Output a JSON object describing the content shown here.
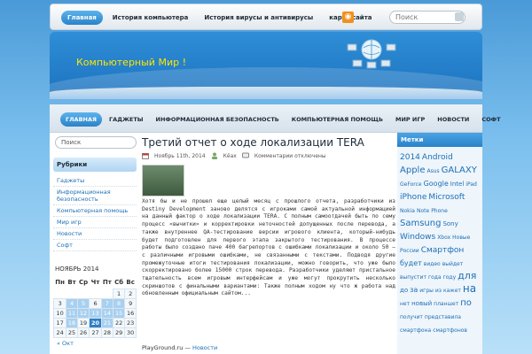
{
  "top_nav": [
    "Главная",
    "История компьютера",
    "История вирусы и антивирусы",
    "карта сайта"
  ],
  "top_search_placeholder": "Поиск",
  "site_title": "Компьютерный Мир !",
  "main_nav": [
    "ГЛАВНАЯ",
    "ГАДЖЕТЫ",
    "ИНФОРМАЦИОННАЯ БЕЗОПАСНОСТЬ",
    "КОМПЬЮТЕРНАЯ ПОМОЩЬ",
    "МИР ИГР",
    "НОВОСТИ",
    "СОФТ"
  ],
  "left": {
    "search_placeholder": "Поиск",
    "rubrics_title": "Рубрики",
    "rubrics": [
      "Гаджеты",
      "Информационная безопасность",
      "Компьютерная помощь",
      "Мир игр",
      "Новости",
      "Софт"
    ],
    "calendar_caption": "НОЯБРЬ 2014",
    "weekdays": [
      "Пн",
      "Вт",
      "Ср",
      "Чт",
      "Пт",
      "Сб",
      "Вс"
    ],
    "weeks": [
      [
        "",
        "",
        "",
        "",
        "",
        "1",
        "2"
      ],
      [
        "3",
        "4",
        "5",
        "6",
        "7",
        "8",
        "9"
      ],
      [
        "10",
        "11",
        "12",
        "13",
        "14",
        "15",
        "16"
      ],
      [
        "17",
        "18",
        "19",
        "20",
        "21",
        "22",
        "23"
      ],
      [
        "24",
        "25",
        "26",
        "27",
        "28",
        "29",
        "30"
      ]
    ],
    "linked_days": [
      "4",
      "5",
      "7",
      "8",
      "11",
      "12",
      "13",
      "14",
      "15",
      "18",
      "21"
    ],
    "today": "20",
    "prev_month": "« Окт"
  },
  "post": {
    "title": "Третий отчет о ходе локализации TERA",
    "date": "Ноябрь 11th, 2014",
    "author": "Кёах",
    "comments": "Комментарии отключены",
    "body": "Хотя бы и не прошел еще целый месяц с прошлого отчета, разработчики из Destiny Development заново делятся с игроками самой актуальной информацией на данный фактор о ходе локализации TERA. С полным самоотдачей быть по сему процесс «вычитки» и корректировки неточностей допущенных после перевода, а также внутреннее QA-тестирование версии игрового клиента, который-нибудь будет подготовлен для первого этапа закрытого тестирования. В процессе работы было создано паче 400 багрепортов с ошибками локализации и около 50 — с различными игровыми ошибками, не связанными с текстами. Подводя другие промежуточные итоги тестирования локализации, можно говорить, что уже было скорректировано более 15000 строк перевода. Разработчики уделяют пристальное тщательность всем игровым интерфейсам и уже могут прокрутить несколько скриншотов с финальными вариантами: Также полным ходом ну что ж работа над обновленным официальным сайтом...",
    "source": "PlayGround.ru",
    "source_sep": " — ",
    "category": "Новости"
  },
  "tags_title": "Метки",
  "tags": [
    {
      "t": "2014",
      "s": 9
    },
    {
      "t": "Android",
      "s": 9
    },
    {
      "t": "Apple",
      "s": 10
    },
    {
      "t": "Asus",
      "s": 6
    },
    {
      "t": "GALAXY",
      "s": 10
    },
    {
      "t": "GeForce",
      "s": 6
    },
    {
      "t": "Google",
      "s": 8
    },
    {
      "t": "Intel",
      "s": 7
    },
    {
      "t": "iPad",
      "s": 6
    },
    {
      "t": "iPhone",
      "s": 9
    },
    {
      "t": "Microsoft",
      "s": 9
    },
    {
      "t": "Nokia",
      "s": 6
    },
    {
      "t": "Note",
      "s": 6
    },
    {
      "t": "Phone",
      "s": 6
    },
    {
      "t": "Samsung",
      "s": 10
    },
    {
      "t": "Sony",
      "s": 7
    },
    {
      "t": "Windows",
      "s": 9
    },
    {
      "t": "Xbox",
      "s": 6
    },
    {
      "t": "Новые",
      "s": 6
    },
    {
      "t": "России",
      "s": 6
    },
    {
      "t": "Смартфон",
      "s": 9
    },
    {
      "t": "будет",
      "s": 8
    },
    {
      "t": "видео",
      "s": 6
    },
    {
      "t": "выйдет",
      "s": 6
    },
    {
      "t": "выпустит",
      "s": 6
    },
    {
      "t": "года",
      "s": 6
    },
    {
      "t": "году",
      "s": 6
    },
    {
      "t": "для",
      "s": 11
    },
    {
      "t": "до",
      "s": 7
    },
    {
      "t": "за",
      "s": 8
    },
    {
      "t": "игры",
      "s": 6
    },
    {
      "t": "из",
      "s": 6
    },
    {
      "t": "кажет",
      "s": 6
    },
    {
      "t": "на",
      "s": 12
    },
    {
      "t": "нет",
      "s": 6
    },
    {
      "t": "новый",
      "s": 7
    },
    {
      "t": "планшет",
      "s": 6
    },
    {
      "t": "по",
      "s": 10
    },
    {
      "t": "получит",
      "s": 6
    },
    {
      "t": "представила",
      "s": 6
    },
    {
      "t": "смартфона",
      "s": 6
    },
    {
      "t": "смартфонов",
      "s": 6
    }
  ]
}
